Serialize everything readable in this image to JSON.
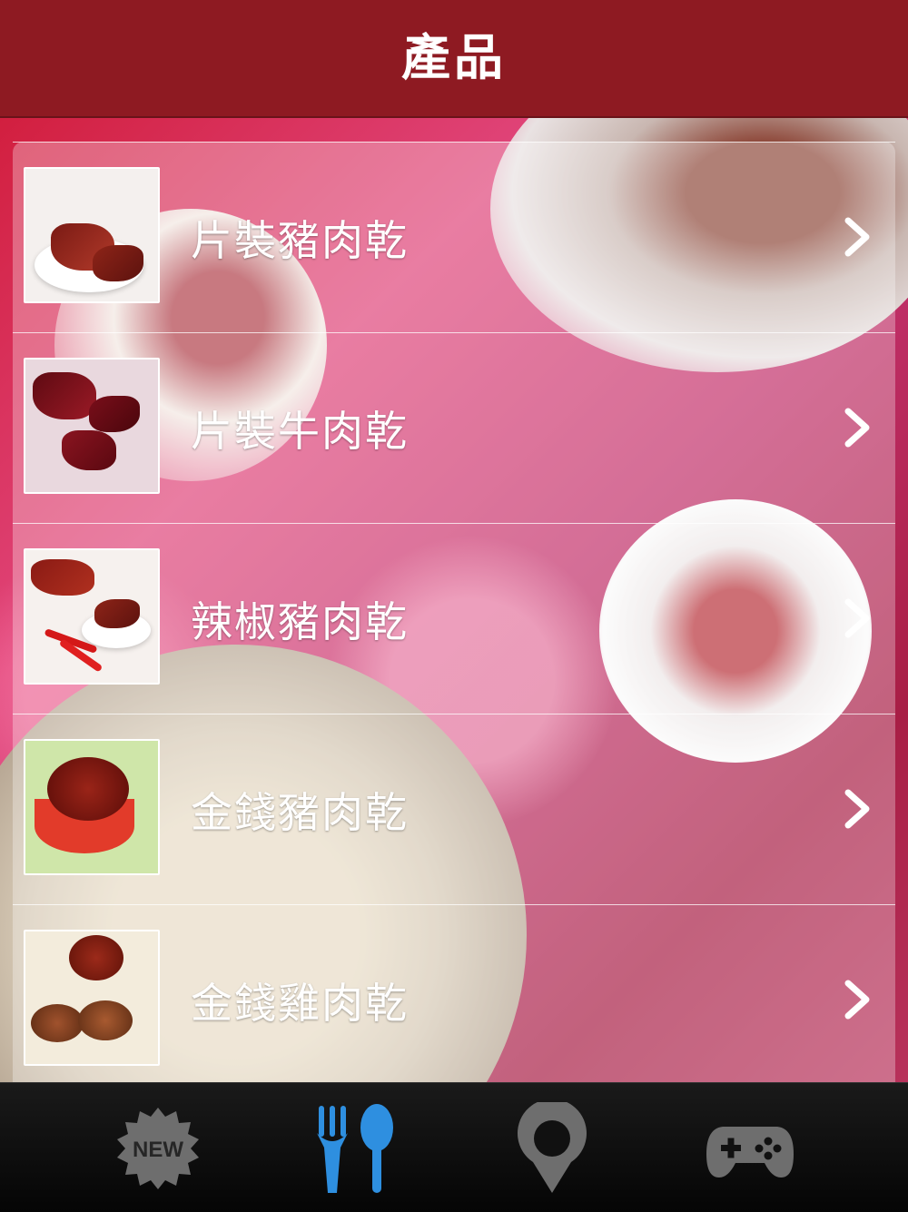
{
  "header": {
    "title": "產品"
  },
  "products": [
    {
      "label": "片裝豬肉乾"
    },
    {
      "label": "片裝牛肉乾"
    },
    {
      "label": "辣椒豬肉乾"
    },
    {
      "label": "金錢豬肉乾"
    },
    {
      "label": "金錢雞肉乾"
    }
  ],
  "tabbar": {
    "tabs": [
      {
        "icon": "new-badge-icon",
        "text": "NEW",
        "active": false
      },
      {
        "icon": "fork-spoon-icon",
        "active": true
      },
      {
        "icon": "map-pin-icon",
        "active": false
      },
      {
        "icon": "gamepad-icon",
        "active": false
      }
    ]
  },
  "colors": {
    "header": "#8e1a22",
    "accent": "#2e8fe0",
    "text": "#ffffff"
  }
}
